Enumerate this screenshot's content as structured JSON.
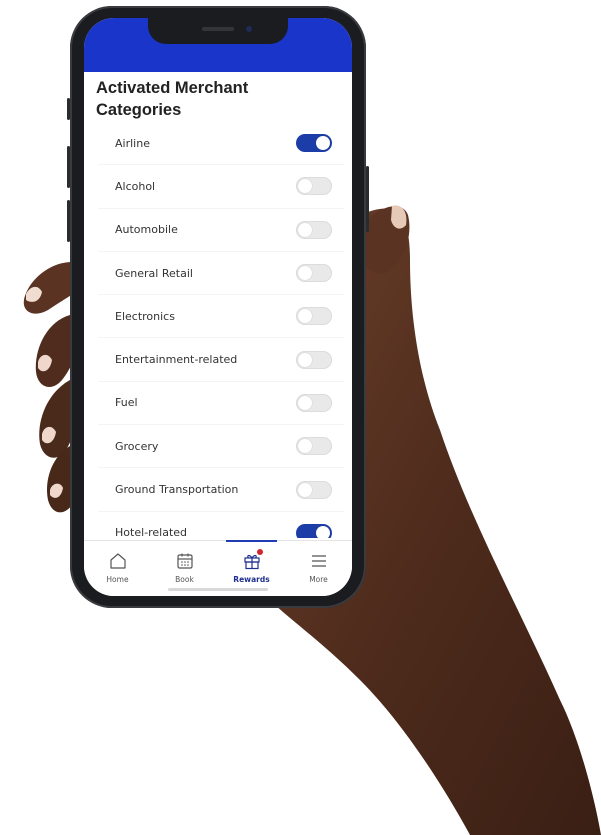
{
  "page": {
    "title": "Activated Merchant Categories"
  },
  "categories": [
    {
      "label": "Airline",
      "enabled": true
    },
    {
      "label": "Alcohol",
      "enabled": false
    },
    {
      "label": "Automobile",
      "enabled": false
    },
    {
      "label": "General Retail",
      "enabled": false
    },
    {
      "label": "Electronics",
      "enabled": false
    },
    {
      "label": "Entertainment-related",
      "enabled": false
    },
    {
      "label": "Fuel",
      "enabled": false
    },
    {
      "label": "Grocery",
      "enabled": false
    },
    {
      "label": "Ground Transportation",
      "enabled": false
    },
    {
      "label": "Hotel-related",
      "enabled": true
    }
  ],
  "tabbar": {
    "items": [
      {
        "label": "Home",
        "icon": "home-icon",
        "active": false
      },
      {
        "label": "Book",
        "icon": "calendar-icon",
        "active": false
      },
      {
        "label": "Rewards",
        "icon": "gift-icon",
        "active": true,
        "badge": true
      },
      {
        "label": "More",
        "icon": "menu-icon",
        "active": false
      }
    ]
  },
  "colors": {
    "status_bar": "#1a35c9",
    "toggle_on": "#1c3ca8",
    "toggle_off": "#e9e9e9",
    "tab_active": "#1f2f8f",
    "badge": "#d1262e"
  }
}
